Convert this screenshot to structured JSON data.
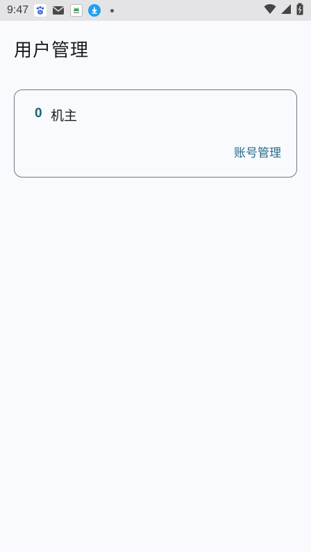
{
  "status_bar": {
    "time": "9:47",
    "notification_icons": [
      "baidu-paw-icon",
      "mail-icon",
      "android-app-icon",
      "download-icon"
    ],
    "right_icons": [
      "wifi-icon",
      "cell-signal-icon",
      "battery-icon"
    ]
  },
  "app_bar": {
    "title": "用户管理"
  },
  "users": [
    {
      "id": "0",
      "name": "机主",
      "action_label": "账号管理"
    }
  ],
  "colors": {
    "background": "#f8fafd",
    "accent": "#2a6987",
    "id_color": "#1a6172",
    "card_border": "#74777f"
  }
}
